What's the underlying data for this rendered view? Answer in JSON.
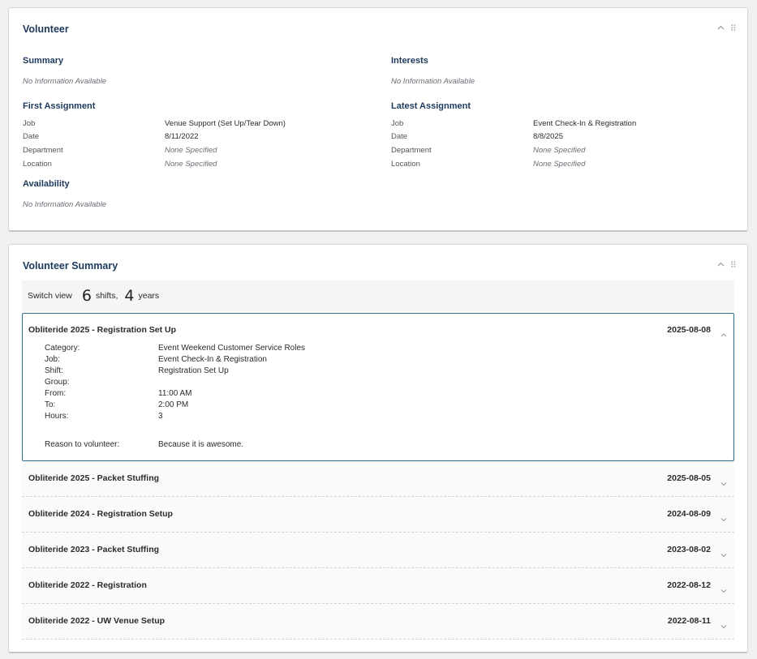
{
  "volunteer": {
    "title": "Volunteer",
    "summary": {
      "heading": "Summary",
      "text": "No Information Available"
    },
    "interests": {
      "heading": "Interests",
      "text": "No Information Available"
    },
    "first_assignment": {
      "heading": "First Assignment",
      "job_label": "Job",
      "job": "Venue Support (Set Up/Tear Down)",
      "date_label": "Date",
      "date": "8/11/2022",
      "department_label": "Department",
      "department": "None Specified",
      "location_label": "Location",
      "location": "None Specified"
    },
    "latest_assignment": {
      "heading": "Latest Assignment",
      "job_label": "Job",
      "job": "Event Check-In & Registration",
      "date_label": "Date",
      "date": "8/8/2025",
      "department_label": "Department",
      "department": "None Specified",
      "location_label": "Location",
      "location": "None Specified"
    },
    "availability": {
      "heading": "Availability",
      "text": "No Information Available"
    }
  },
  "volunteer_summary": {
    "title": "Volunteer Summary",
    "switch_view_label": "Switch view",
    "shifts_count": "6",
    "shifts_label": "shifts,",
    "years_count": "4",
    "years_label": "years",
    "expanded": {
      "title": "Obliteride 2025 - Registration Set Up",
      "date": "2025-08-08",
      "category_label": "Category:",
      "category": "Event Weekend Customer Service Roles",
      "job_label": "Job:",
      "job": "Event Check-In & Registration",
      "shift_label": "Shift:",
      "shift": "Registration Set Up",
      "group_label": "Group:",
      "group": "",
      "from_label": "From:",
      "from": "11:00 AM",
      "to_label": "To:",
      "to": "2:00 PM",
      "hours_label": "Hours:",
      "hours": "3",
      "reason_label": "Reason to volunteer:",
      "reason": "Because it is awesome."
    },
    "shifts": [
      {
        "title": "Obliteride 2025 - Packet Stuffing",
        "date": "2025-08-05"
      },
      {
        "title": "Obliteride 2024 - Registration Setup",
        "date": "2024-08-09"
      },
      {
        "title": "Obliteride 2023 - Packet Stuffing",
        "date": "2023-08-02"
      },
      {
        "title": "Obliteride 2022 - Registration",
        "date": "2022-08-12"
      },
      {
        "title": "Obliteride 2022 - UW Venue Setup",
        "date": "2022-08-11"
      }
    ]
  },
  "icons": {
    "collapse": "chevron-up-icon",
    "drag": "drag-handle-icon",
    "expand": "chevron-down-icon"
  },
  "colors": {
    "heading": "#1d3a5c",
    "expanded_border": "#2e6b8c",
    "muted": "#6a7077"
  }
}
